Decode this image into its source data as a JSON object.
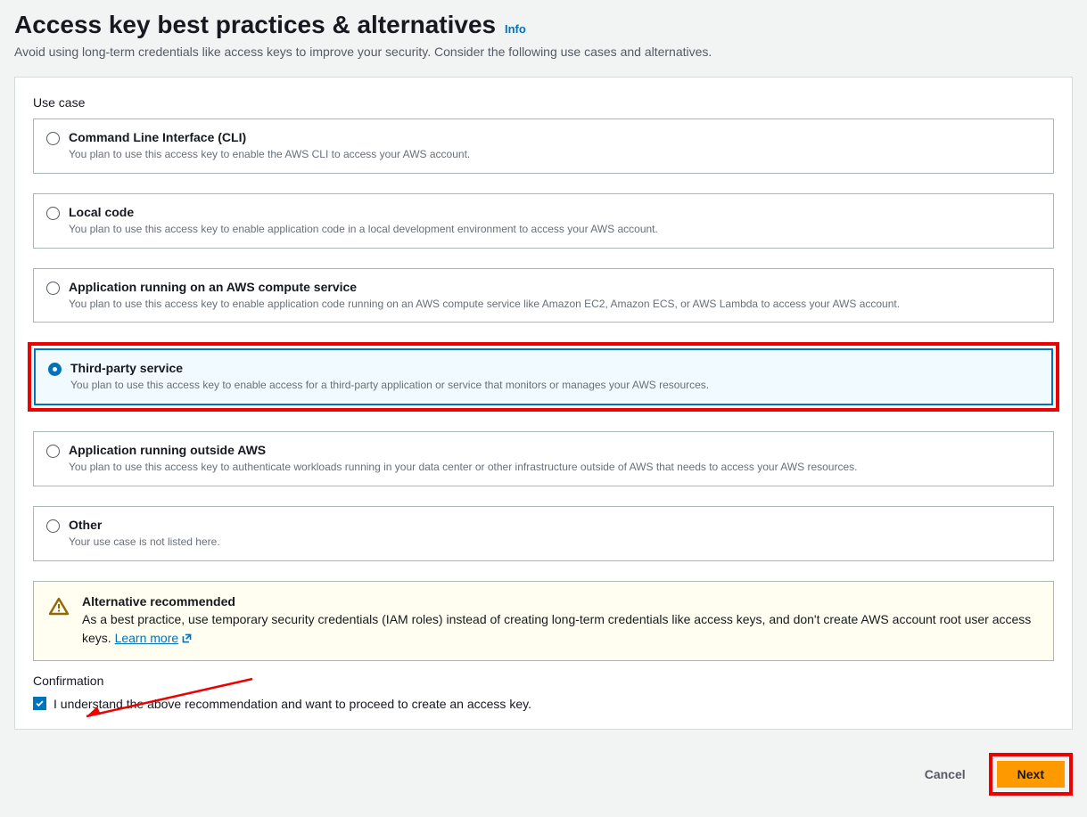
{
  "header": {
    "title": "Access key best practices & alternatives",
    "info_label": "Info",
    "subtitle": "Avoid using long-term credentials like access keys to improve your security. Consider the following use cases and alternatives."
  },
  "usecase": {
    "label": "Use case",
    "options": [
      {
        "title": "Command Line Interface (CLI)",
        "desc": "You plan to use this access key to enable the AWS CLI to access your AWS account."
      },
      {
        "title": "Local code",
        "desc": "You plan to use this access key to enable application code in a local development environment to access your AWS account."
      },
      {
        "title": "Application running on an AWS compute service",
        "desc": "You plan to use this access key to enable application code running on an AWS compute service like Amazon EC2, Amazon ECS, or AWS Lambda to access your AWS account."
      },
      {
        "title": "Third-party service",
        "desc": "You plan to use this access key to enable access for a third-party application or service that monitors or manages your AWS resources."
      },
      {
        "title": "Application running outside AWS",
        "desc": "You plan to use this access key to authenticate workloads running in your data center or other infrastructure outside of AWS that needs to access your AWS resources."
      },
      {
        "title": "Other",
        "desc": "Your use case is not listed here."
      }
    ]
  },
  "alert": {
    "title": "Alternative recommended",
    "text": "As a best practice, use temporary security credentials (IAM roles) instead of creating long-term credentials like access keys, and don't create AWS account root user access keys.",
    "learn_more": "Learn more"
  },
  "confirmation": {
    "label": "Confirmation",
    "checkbox_label": "I understand the above recommendation and want to proceed to create an access key."
  },
  "footer": {
    "cancel": "Cancel",
    "next": "Next"
  },
  "colors": {
    "accent_blue": "#0073bb",
    "accent_orange": "#ff9900",
    "highlight_red": "#ee0000"
  }
}
